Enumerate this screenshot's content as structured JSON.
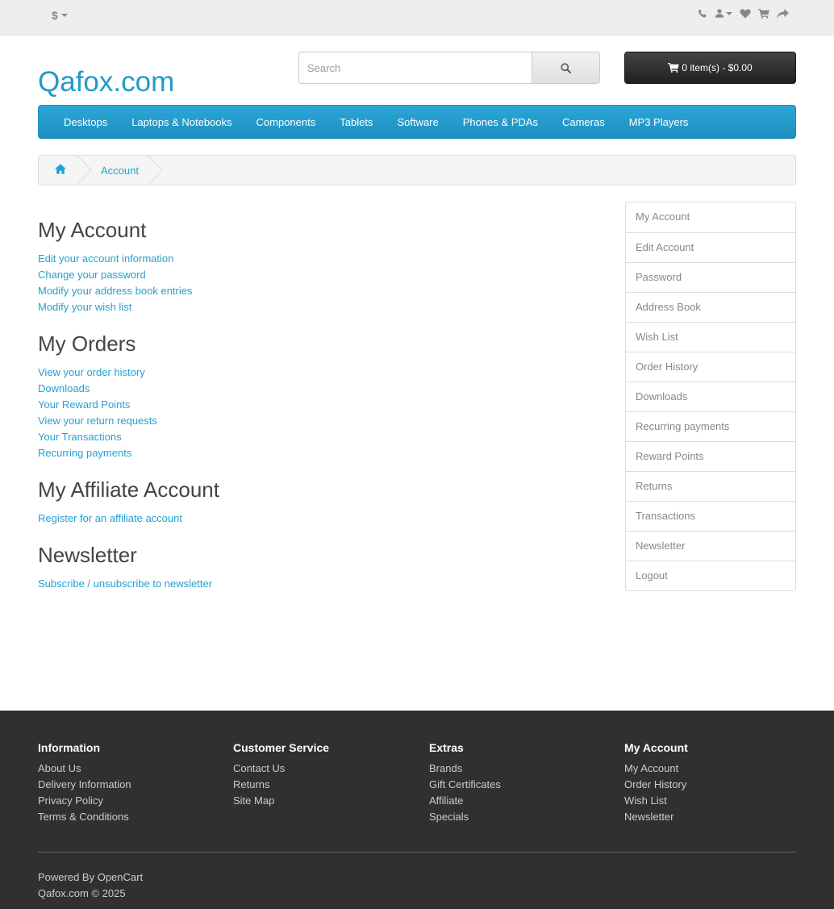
{
  "topbar": {
    "currency_symbol": "$",
    "icons": [
      "phone-icon",
      "user-icon",
      "heart-icon",
      "cart-icon",
      "share-icon"
    ]
  },
  "header": {
    "logo": "Qafox.com",
    "search_placeholder": "Search",
    "cart_label": "0 item(s) - $0.00"
  },
  "menu": {
    "items": [
      "Desktops",
      "Laptops & Notebooks",
      "Components",
      "Tablets",
      "Software",
      "Phones & PDAs",
      "Cameras",
      "MP3 Players"
    ]
  },
  "breadcrumb": {
    "current": "Account"
  },
  "content": {
    "sections": [
      {
        "title": "My Account",
        "links": [
          "Edit your account information",
          "Change your password",
          "Modify your address book entries",
          "Modify your wish list"
        ]
      },
      {
        "title": "My Orders",
        "links": [
          "View your order history",
          "Downloads",
          "Your Reward Points",
          "View your return requests",
          "Your Transactions",
          "Recurring payments"
        ]
      },
      {
        "title": "My Affiliate Account",
        "links": [
          "Register for an affiliate account"
        ]
      },
      {
        "title": "Newsletter",
        "links": [
          "Subscribe / unsubscribe to newsletter"
        ]
      }
    ]
  },
  "sidebar": {
    "items": [
      "My Account",
      "Edit Account",
      "Password",
      "Address Book",
      "Wish List",
      "Order History",
      "Downloads",
      "Recurring payments",
      "Reward Points",
      "Returns",
      "Transactions",
      "Newsletter",
      "Logout"
    ]
  },
  "footer": {
    "columns": [
      {
        "title": "Information",
        "links": [
          "About Us",
          "Delivery Information",
          "Privacy Policy",
          "Terms & Conditions"
        ]
      },
      {
        "title": "Customer Service",
        "links": [
          "Contact Us",
          "Returns",
          "Site Map"
        ]
      },
      {
        "title": "Extras",
        "links": [
          "Brands",
          "Gift Certificates",
          "Affiliate",
          "Specials"
        ]
      },
      {
        "title": "My Account",
        "links": [
          "My Account",
          "Order History",
          "Wish List",
          "Newsletter"
        ]
      }
    ],
    "powered_prefix": "Powered By",
    "powered_link": "OpenCart",
    "copyright": "Qafox.com © 2025"
  },
  "colors": {
    "accent": "#229ac8",
    "link": "#23a1d1",
    "footer_bg": "#303030"
  }
}
